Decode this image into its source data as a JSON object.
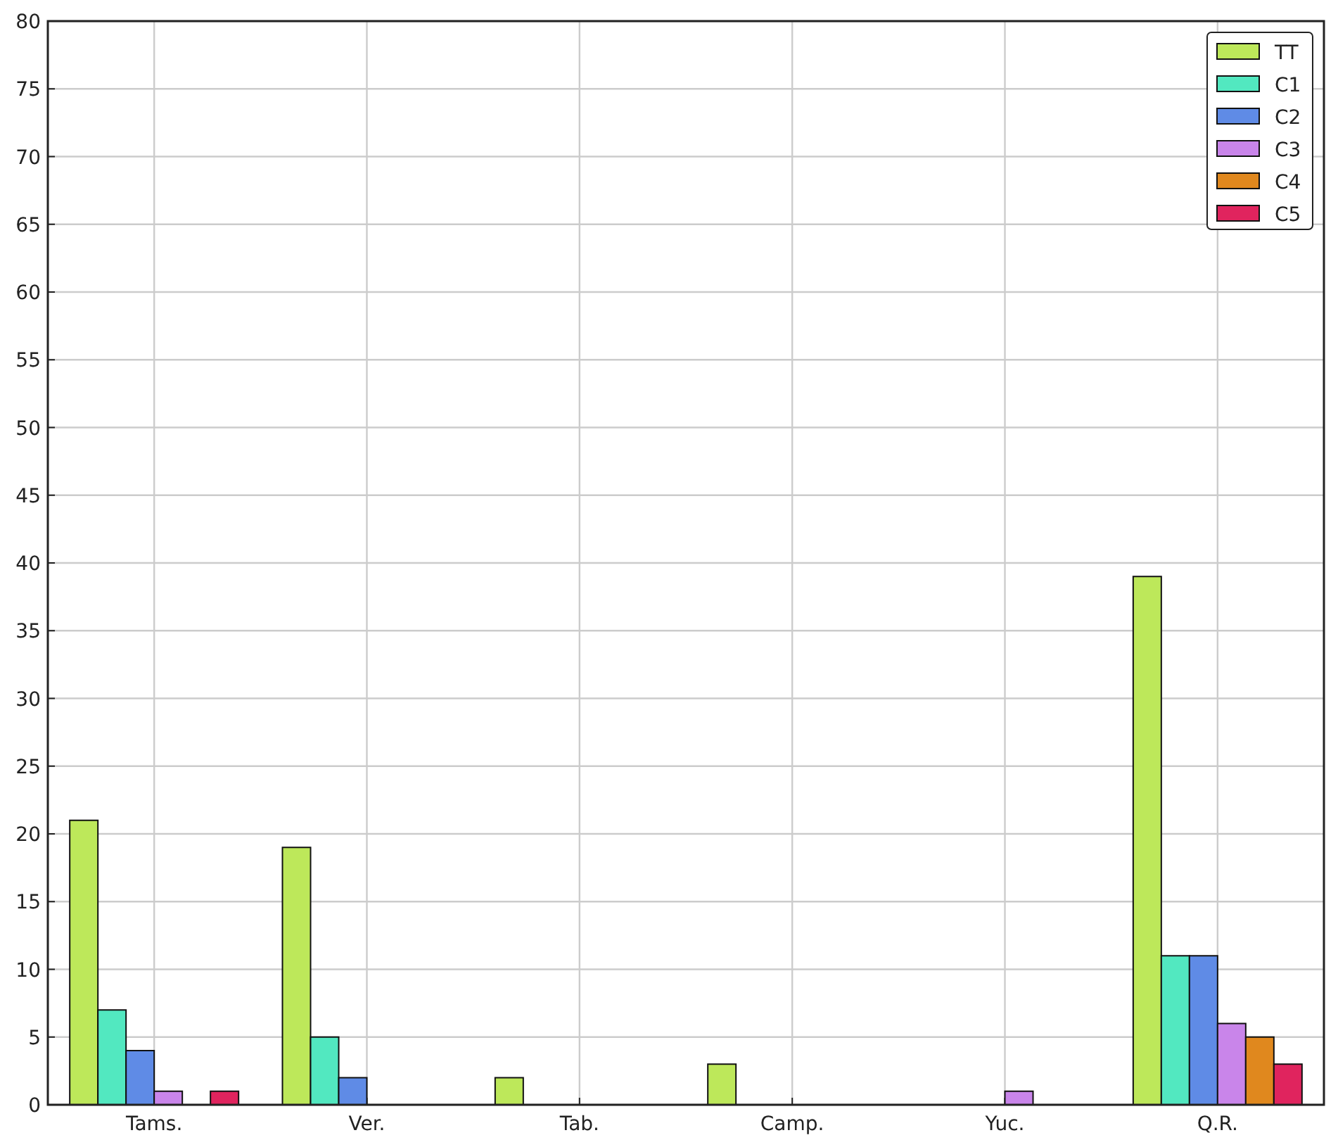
{
  "chart_data": {
    "type": "bar",
    "categories": [
      "Tams.",
      "Ver.",
      "Tab.",
      "Camp.",
      "Yuc.",
      "Q.R."
    ],
    "series": [
      {
        "name": "TT",
        "color": "#bde85a",
        "values": [
          21,
          19,
          2,
          3,
          0,
          39
        ]
      },
      {
        "name": "C1",
        "color": "#52e8c0",
        "values": [
          7,
          5,
          0,
          0,
          0,
          11
        ]
      },
      {
        "name": "C2",
        "color": "#5f8be6",
        "values": [
          4,
          2,
          0,
          0,
          0,
          11
        ]
      },
      {
        "name": "C3",
        "color": "#c985ea",
        "values": [
          1,
          0,
          0,
          0,
          1,
          6
        ]
      },
      {
        "name": "C4",
        "color": "#e0881e",
        "values": [
          0,
          0,
          0,
          0,
          0,
          5
        ]
      },
      {
        "name": "C5",
        "color": "#e0245e",
        "values": [
          1,
          0,
          0,
          0,
          0,
          3
        ]
      }
    ],
    "grid": true,
    "legend": true,
    "ylim": [
      0,
      80
    ],
    "yticks": [
      0,
      5,
      10,
      15,
      20,
      25,
      30,
      35,
      40,
      45,
      50,
      55,
      60,
      65,
      70,
      75,
      80
    ]
  }
}
